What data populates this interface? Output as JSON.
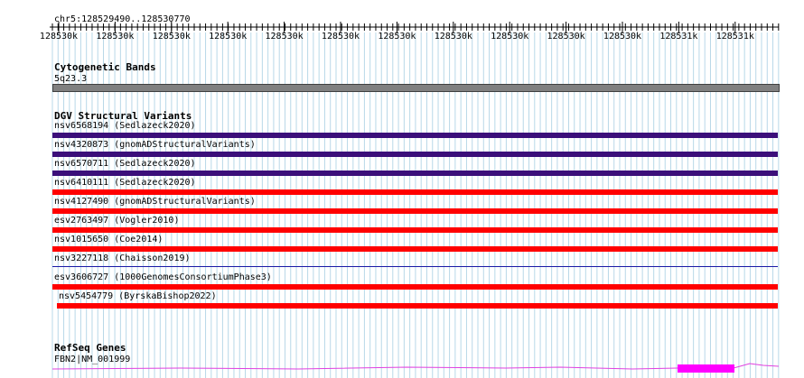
{
  "ruler": {
    "location": "chr5:128529490..128530770",
    "ticks": [
      "128530k",
      "128530k",
      "128530k",
      "128530k",
      "128530k",
      "128530k",
      "128530k",
      "128530k",
      "128530k",
      "128530k",
      "128530k",
      "128531k",
      "128531k"
    ]
  },
  "cytoband": {
    "title": "Cytogenetic Bands",
    "band": "5q23.3"
  },
  "dgv": {
    "title": "DGV Structural Variants",
    "variants": [
      {
        "label": "nsv6568194 (Sedlazeck2020)",
        "color": "#3b0f7a"
      },
      {
        "label": "nsv4320873 (gnomADStructuralVariants)",
        "color": "#3b0f7a"
      },
      {
        "label": "nsv6570711 (Sedlazeck2020)",
        "color": "#3b0f7a"
      },
      {
        "label": "nsv6410111 (Sedlazeck2020)",
        "color": "#ff0000"
      },
      {
        "label": "nsv4127490 (gnomADStructuralVariants)",
        "color": "#ff0000"
      },
      {
        "label": "esv2763497 (Vogler2010)",
        "color": "#ff0000"
      },
      {
        "label": "nsv1015650 (Coe2014)",
        "color": "#ff0000"
      },
      {
        "label": "nsv3227118 (Chaisson2019)",
        "color": "#1a1aa6"
      },
      {
        "label": "esv3606727 (1000GenomesConsortiumPhase3)",
        "color": "#ff0000"
      },
      {
        "label": "nsv5454779 (ByrskaBishop2022)",
        "color": "#ff0000"
      }
    ]
  },
  "refseq": {
    "title": "RefSeq Genes",
    "gene": "FBN2|NM_001999",
    "intron_color": "#e040e0",
    "exon_color": "#ff00ff"
  },
  "colors": {
    "grid": "#b8d8e8",
    "cyto_band": "#808080"
  }
}
